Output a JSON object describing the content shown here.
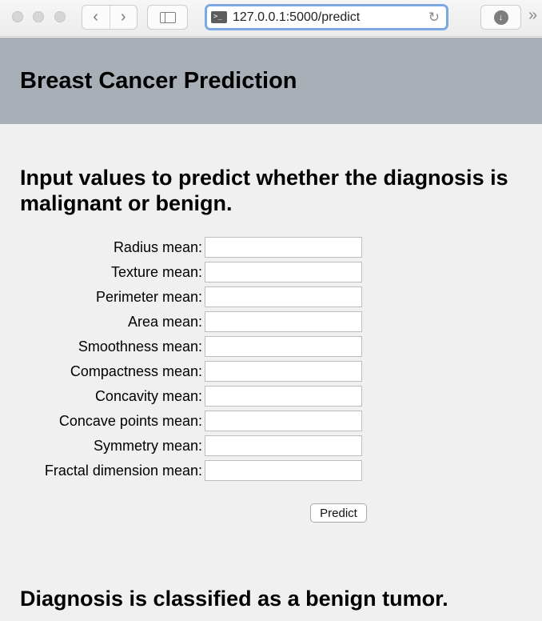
{
  "browser": {
    "url": "127.0.0.1:5000/predict",
    "icons": {
      "back": "chevron-left-icon",
      "forward": "chevron-right-icon",
      "sidebar": "sidebar-icon",
      "site": "terminal-icon",
      "reload": "reload-icon",
      "download": "download-icon",
      "overflow": "double-chevron-right-icon"
    }
  },
  "header": {
    "title": "Breast Cancer Prediction",
    "background_color": "#a9afb7"
  },
  "main": {
    "instructions": "Input values to predict whether the diagnosis is malignant or benign.",
    "fields": [
      {
        "label": "Radius mean:",
        "value": ""
      },
      {
        "label": "Texture mean:",
        "value": ""
      },
      {
        "label": "Perimeter mean:",
        "value": ""
      },
      {
        "label": "Area mean:",
        "value": ""
      },
      {
        "label": "Smoothness mean:",
        "value": ""
      },
      {
        "label": "Compactness mean:",
        "value": ""
      },
      {
        "label": "Concavity mean:",
        "value": ""
      },
      {
        "label": "Concave points mean:",
        "value": ""
      },
      {
        "label": "Symmetry mean:",
        "value": ""
      },
      {
        "label": "Fractal dimension mean:",
        "value": ""
      }
    ],
    "predict_label": "Predict",
    "result": "Diagnosis is classified as a benign tumor."
  }
}
